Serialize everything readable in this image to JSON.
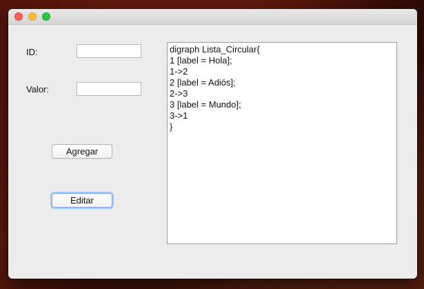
{
  "window": {
    "controls": [
      "close",
      "minimize",
      "maximize"
    ]
  },
  "form": {
    "id_label": "ID:",
    "id_value": "",
    "value_label": "Valor:",
    "value_value": ""
  },
  "buttons": {
    "add_label": "Agregar",
    "edit_label": "Editar"
  },
  "output": {
    "lines": [
      "digraph Lista_Circular{",
      "1 [label = Hola];",
      "1->2",
      "2 [label = Adiós];",
      "2->3",
      "3 [label = Mundo];",
      "3->1",
      "}"
    ]
  },
  "colors": {
    "close": "#fe5f57",
    "minimize": "#febc2e",
    "maximize": "#28c840",
    "focus_ring": "#a9c8f2"
  }
}
